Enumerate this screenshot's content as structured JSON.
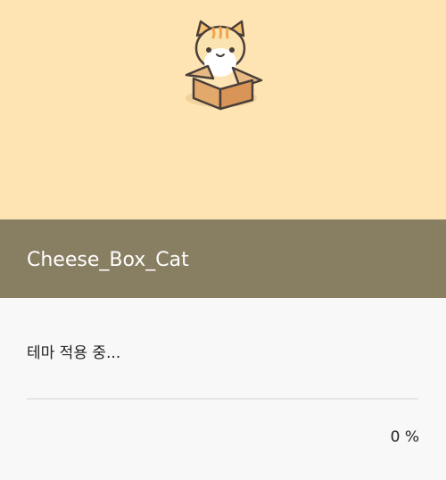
{
  "theme": {
    "name": "Cheese_Box_Cat",
    "preview_icon": "cat-in-box-illustration"
  },
  "status": {
    "message": "테마 적용 중...",
    "progress_fraction": 0,
    "progress_label": "0 %"
  },
  "colors": {
    "banner_background": "#ffe4b3",
    "title_bar_background": "#887e62",
    "panel_background": "#f8f8f8"
  }
}
